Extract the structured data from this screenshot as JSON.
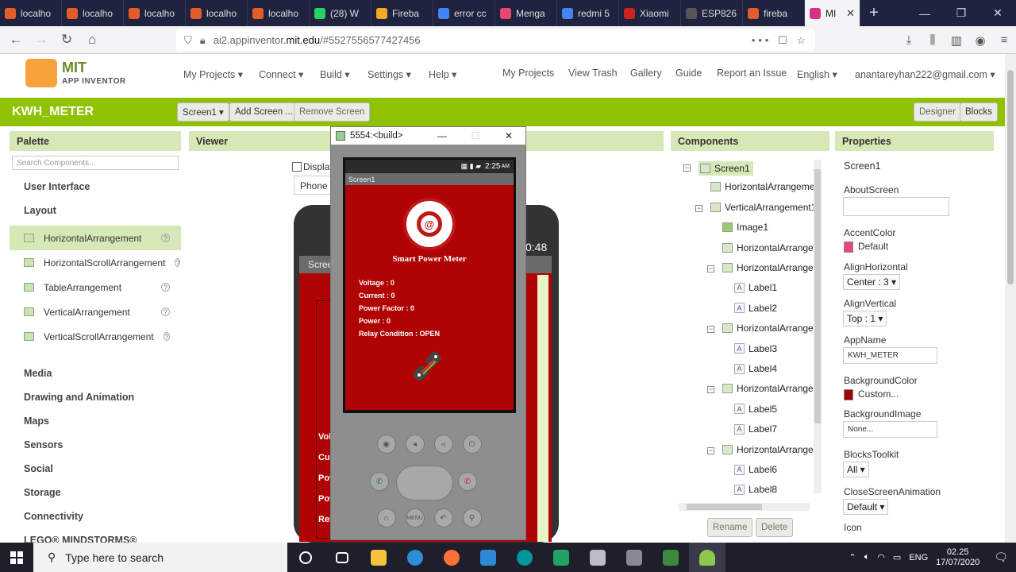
{
  "browser": {
    "tabs": [
      {
        "label": "localho",
        "color": "#e35c2b"
      },
      {
        "label": "localho",
        "color": "#e35c2b"
      },
      {
        "label": "localho",
        "color": "#e35c2b"
      },
      {
        "label": "localho",
        "color": "#e35c2b"
      },
      {
        "label": "localho",
        "color": "#e35c2b"
      },
      {
        "label": "(28) W",
        "color": "#25d366"
      },
      {
        "label": "Fireba",
        "color": "#f7a823"
      },
      {
        "label": "error cc",
        "color": "#4285f4"
      },
      {
        "label": "Menga",
        "color": "#e8476f"
      },
      {
        "label": "redmi 5",
        "color": "#4285f4"
      },
      {
        "label": "Xiaomi",
        "color": "#cc2222"
      },
      {
        "label": "ESP826",
        "color": "#555555"
      },
      {
        "label": "fireba",
        "color": "#e35c2b"
      },
      {
        "label": "MI",
        "color": "#d63384"
      }
    ],
    "url_host": "ai2.appinventor.",
    "url_domain": "mit.edu",
    "url_path": "/#5527556577427456"
  },
  "header": {
    "logo_top": "MIT",
    "logo_bottom": "APP INVENTOR",
    "menus": [
      "My Projects ▾",
      "Connect ▾",
      "Build ▾",
      "Settings ▾",
      "Help ▾"
    ],
    "links": [
      "My Projects",
      "View Trash",
      "Gallery",
      "Guide",
      "Report an Issue",
      "English ▾"
    ],
    "account": "anantareyhan222@gmail.com ▾"
  },
  "titlebar": {
    "project": "KWH_METER",
    "screen_select": "Screen1 ▾",
    "add_screen": "Add Screen ...",
    "remove_screen": "Remove Screen",
    "designer": "Designer",
    "blocks": "Blocks"
  },
  "palette": {
    "title": "Palette",
    "search_placeholder": "Search Components...",
    "categories_top": [
      "User Interface",
      "Layout"
    ],
    "layout_items": [
      "HorizontalArrangement",
      "HorizontalScrollArrangement",
      "TableArrangement",
      "VerticalArrangement",
      "VerticalScrollArrangement"
    ],
    "categories_bottom": [
      "Media",
      "Drawing and Animation",
      "Maps",
      "Sensors",
      "Social",
      "Storage",
      "Connectivity",
      "LEGO® MINDSTORMS®"
    ]
  },
  "viewer": {
    "title": "Viewer",
    "display_label": "Display",
    "phone_label": "Phone",
    "phone_time": "0:48",
    "screen_label": "Scree",
    "side_labels": [
      "Vol",
      "Cur",
      "Pov",
      "Pov",
      "Rel"
    ]
  },
  "emulator": {
    "title": "5554:<build>",
    "time": "2:25",
    "time_suffix": "AM",
    "screen_title": "Screen1",
    "app_title": "Smart Power Meter",
    "readings": [
      "Voltage : 0",
      "Current : 0",
      "Power Factor : 0",
      "Power : 0",
      "Relay Condition : OPEN"
    ],
    "menu_label": "MENU"
  },
  "components": {
    "title": "Components",
    "tree": [
      "Screen1",
      "HorizontalArrangemer",
      "VerticalArrangement1",
      "Image1",
      "HorizontalArrangen",
      "HorizontalArrangen",
      "Label1",
      "Label2",
      "HorizontalArrangen",
      "Label3",
      "Label4",
      "HorizontalArrangen",
      "Label5",
      "Label7",
      "HorizontalArrangen",
      "Label6",
      "Label8"
    ],
    "rename": "Rename",
    "delete": "Delete"
  },
  "properties": {
    "title": "Properties",
    "component": "Screen1",
    "about_screen": "AboutScreen",
    "accent_color": "AccentColor",
    "accent_value": "Default",
    "align_h": "AlignHorizontal",
    "align_h_value": "Center : 3 ▾",
    "align_v": "AlignVertical",
    "align_v_value": "Top : 1 ▾",
    "app_name": "AppName",
    "app_name_value": "KWH_METER",
    "bg_color": "BackgroundColor",
    "bg_color_value": "Custom...",
    "bg_image": "BackgroundImage",
    "bg_image_value": "None...",
    "blocks_toolkit": "BlocksToolkit",
    "blocks_toolkit_value": "All ▾",
    "close_anim": "CloseScreenAnimation",
    "close_anim_value": "Default ▾",
    "icon": "Icon",
    "accent_swatch": "#e8477a",
    "bg_swatch": "#a00000"
  },
  "taskbar": {
    "search_placeholder": "Type here to search",
    "lang": "ENG",
    "time": "02.25",
    "date": "17/07/2020"
  }
}
